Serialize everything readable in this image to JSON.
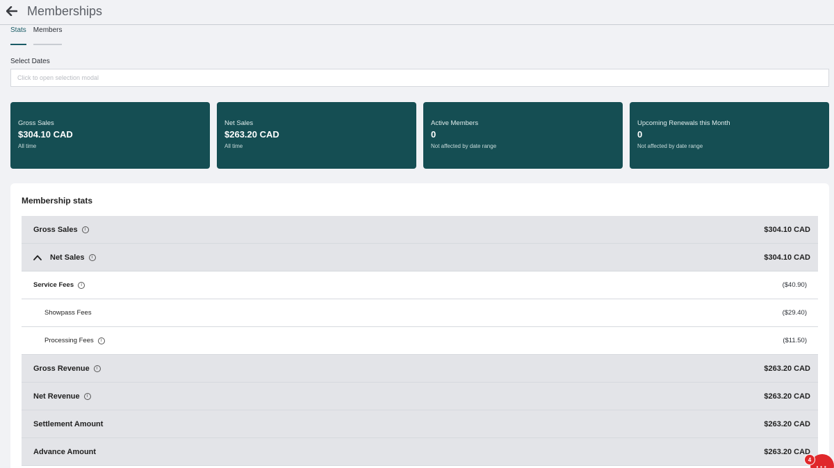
{
  "header": {
    "title": "Memberships"
  },
  "tabs": [
    {
      "label": "Stats",
      "active": true
    },
    {
      "label": "Members",
      "active": false
    }
  ],
  "dates": {
    "label": "Select Dates",
    "placeholder": "Click to open selection modal"
  },
  "cards": [
    {
      "label": "Gross Sales",
      "value": "$304.10 CAD",
      "sub": "All time"
    },
    {
      "label": "Net Sales",
      "value": "$263.20 CAD",
      "sub": "All time"
    },
    {
      "label": "Active Members",
      "value": "0",
      "sub": "Not affected by date range"
    },
    {
      "label": "Upcoming Renewals this Month",
      "value": "0",
      "sub": "Not affected by date range"
    }
  ],
  "stats": {
    "title": "Membership stats",
    "rows": [
      {
        "label": "Gross Sales",
        "value": "$304.10 CAD"
      },
      {
        "label": "Net Sales",
        "value": "$304.10 CAD"
      },
      {
        "label": "Service Fees",
        "value": "($40.90)"
      },
      {
        "label": "Showpass Fees",
        "value": "($29.40)"
      },
      {
        "label": "Processing Fees",
        "value": "($11.50)"
      },
      {
        "label": "Gross Revenue",
        "value": "$263.20 CAD"
      },
      {
        "label": "Net Revenue",
        "value": "$263.20 CAD"
      },
      {
        "label": "Settlement Amount",
        "value": "$263.20 CAD"
      },
      {
        "label": "Advance Amount",
        "value": "$263.20 CAD"
      }
    ]
  },
  "chat": {
    "badge": "4",
    "dots": "···"
  },
  "colors": {
    "card_bg": "#154e53",
    "accent": "#1a5c66",
    "chat": "#e0282b"
  }
}
